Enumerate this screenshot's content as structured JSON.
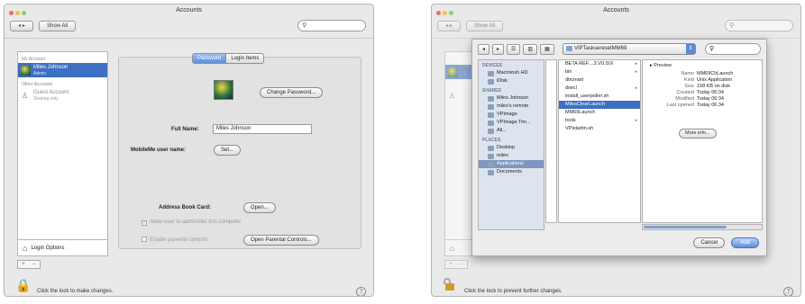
{
  "left_window": {
    "title": "Accounts",
    "nav_label": "◂ ▸",
    "show_all": "Show All",
    "search_placeholder": "",
    "sidebar": {
      "my_account_header": "My Account",
      "my_account_name": "Miles Johnson",
      "my_account_role": "Admin",
      "other_accounts_header": "Other Accounts",
      "guest_name": "Guest Account",
      "guest_sub": "Sharing only"
    },
    "login_options": "Login Options",
    "plus_minus": [
      "+",
      "–"
    ],
    "tabs": [
      "Password",
      "Login Items"
    ],
    "change_password": "Change Password...",
    "full_name_label": "Full Name:",
    "full_name_value": "Miles Johnson",
    "mobileme_label": "MobileMe user name:",
    "set_button": "Set...",
    "address_book_label": "Address Book Card:",
    "open_button": "Open...",
    "allow_admin": "Allow user to administer this computer",
    "enable_parental": "Enable parental controls",
    "open_parental": "Open Parental Controls...",
    "lock_text": "Click the lock to make changes.",
    "help": "?"
  },
  "right_window": {
    "title": "Accounts",
    "nav_label": "◂ ▸",
    "show_all": "Show All",
    "lock_text": "Click the lock to prevent further changes.",
    "help": "?",
    "sheet": {
      "nav_buttons": [
        "◂",
        "▸"
      ],
      "view_buttons": [
        "☰",
        "▥",
        "▦"
      ],
      "path": "VIPTaskseresetMM69",
      "sidebar": {
        "devices_header": "DEVICES",
        "devices": [
          "Macintosh HD",
          "iDisk"
        ],
        "shared_header": "SHARED",
        "shared": [
          "Miles Johnson",
          "miles's remote",
          "VPImage",
          "VPImage Tim...",
          "All..."
        ],
        "places_header": "PLACES",
        "places": [
          "Desktop",
          "miles",
          "Applications",
          "Documents"
        ]
      },
      "files": [
        {
          "name": "BETA REF....3.V0.SIX",
          "chevron": true
        },
        {
          "name": "bin",
          "chevron": true
        },
        {
          "name": "dtrcmart",
          "chevron": false
        },
        {
          "name": "dsecl",
          "chevron": true
        },
        {
          "name": "install_userpoller.sh",
          "chevron": false
        },
        {
          "name": "MilesClearLaunch",
          "chevron": false,
          "selected": true
        },
        {
          "name": "MM69Launch",
          "chevron": false
        },
        {
          "name": "tools",
          "chevron": true
        },
        {
          "name": "VPIstartin.sh",
          "chevron": false
        }
      ],
      "preview": {
        "header": "▸ Preview",
        "rows": [
          {
            "k": "Name",
            "v": "MM69ClrLaunch"
          },
          {
            "k": "Kind",
            "v": "Unix Application"
          },
          {
            "k": "Size",
            "v": "158 KB on disk"
          },
          {
            "k": "Created",
            "v": "Today 06:34"
          },
          {
            "k": "Modified",
            "v": "Today 06:34"
          },
          {
            "k": "Last opened",
            "v": "Today 06:34"
          }
        ],
        "more_info": "More info..."
      },
      "cancel": "Cancel",
      "add": "Add"
    }
  }
}
